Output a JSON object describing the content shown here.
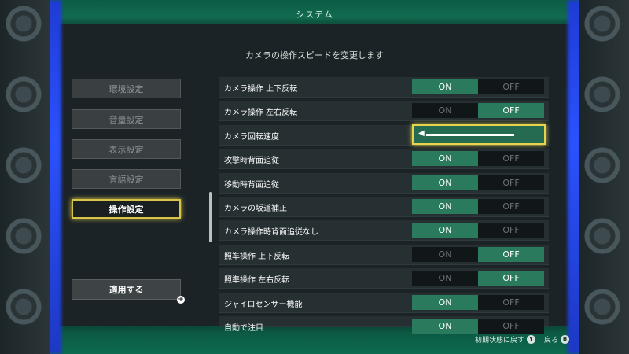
{
  "window": {
    "title": "システム"
  },
  "description": "カメラの操作スピードを変更します",
  "menu": {
    "items": [
      {
        "label": "環境設定",
        "active": false
      },
      {
        "label": "音量設定",
        "active": false
      },
      {
        "label": "表示設定",
        "active": false
      },
      {
        "label": "言語設定",
        "active": false
      },
      {
        "label": "操作設定",
        "active": true
      }
    ],
    "apply_label": "適用する"
  },
  "toggle_labels": {
    "on": "ON",
    "off": "OFF"
  },
  "settings": [
    {
      "label": "カメラ操作 上下反転",
      "type": "toggle",
      "value": "ON"
    },
    {
      "label": "カメラ操作 左右反転",
      "type": "toggle",
      "value": "OFF"
    },
    {
      "label": "カメラ回転速度",
      "type": "slider",
      "level": 0.85,
      "icon": "chevron-left-icon"
    },
    {
      "label": "攻撃時背面追従",
      "type": "toggle",
      "value": "ON"
    },
    {
      "label": "移動時背面追従",
      "type": "toggle",
      "value": "ON"
    },
    {
      "label": "カメラの坂道補正",
      "type": "toggle",
      "value": "ON"
    },
    {
      "label": "カメラ操作時背面追従なし",
      "type": "toggle",
      "value": "ON"
    },
    {
      "label": "照準操作 上下反転",
      "type": "toggle",
      "value": "OFF"
    },
    {
      "label": "照準操作 左右反転",
      "type": "toggle",
      "value": "OFF"
    },
    {
      "label": "ジャイロセンサー機能",
      "type": "toggle",
      "value": "ON"
    },
    {
      "label": "自動で注目",
      "type": "toggle",
      "value": "ON"
    }
  ],
  "hints": {
    "reset_label": "初期状態に戻す",
    "reset_button": "Y",
    "back_label": "戻る",
    "back_button": "B"
  },
  "colors": {
    "accent_green": "#2a7a5e",
    "focus_yellow": "#e8d34f",
    "frame_glow": "#2b52ff"
  }
}
